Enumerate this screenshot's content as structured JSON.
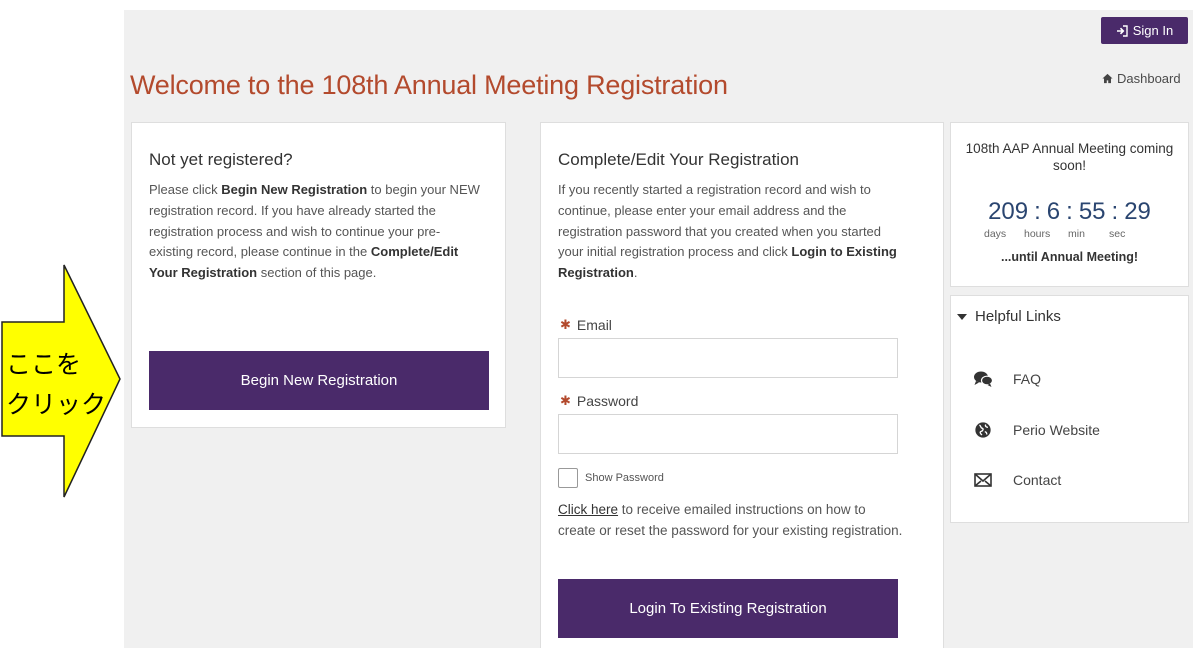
{
  "header": {
    "signin_label": "Sign In",
    "dashboard_label": "Dashboard",
    "page_title": "Welcome to the 108th Annual Meeting Registration"
  },
  "new_registration": {
    "heading": "Not yet registered?",
    "text_1": "Please click ",
    "bold_1": "Begin New Registration",
    "text_2": " to begin your NEW registration record.  If you have already started the registration process and wish to continue your pre-existing record, please continue in the ",
    "bold_2": "Complete/Edit Your Registration",
    "text_3": " section of this page.",
    "button_label": "Begin New Registration"
  },
  "existing_registration": {
    "heading": "Complete/Edit Your Registration",
    "text_1": "If you recently started a registration record and wish to continue, please enter your email address and the registration password that you created when you started your initial registration process and click ",
    "bold_1": "Login to Existing Registration",
    "text_2": ".",
    "required_marker": "✱",
    "email_label": "Email",
    "email_value": "",
    "password_label": "Password",
    "password_value": "",
    "show_password_label": "Show Password",
    "show_password_checked": false,
    "help_link": "Click here",
    "help_text": " to receive emailed instructions on how to create or reset the password for your existing registration.",
    "button_label": "Login To Existing Registration"
  },
  "countdown": {
    "heading": "108th AAP Annual Meeting coming soon!",
    "days": "209",
    "hours": "6",
    "minutes": "55",
    "seconds": "29",
    "separator": ":",
    "days_label": "days",
    "hours_label": "hours",
    "minutes_label": "min",
    "seconds_label": "sec",
    "until_label": "...until Annual Meeting!"
  },
  "helpful_links": {
    "heading": "Helpful Links",
    "items": [
      {
        "label": "FAQ",
        "icon": "comments-icon"
      },
      {
        "label": "Perio Website",
        "icon": "globe-icon"
      },
      {
        "label": "Contact",
        "icon": "envelope-icon"
      }
    ]
  },
  "annotation": {
    "text_line_1": "ここを",
    "text_line_2": "クリック",
    "fill_color": "#ffff00"
  },
  "colors": {
    "accent_purple": "#4a2a6a",
    "title_red": "#b34a2d",
    "countdown_blue": "#2a4570"
  }
}
